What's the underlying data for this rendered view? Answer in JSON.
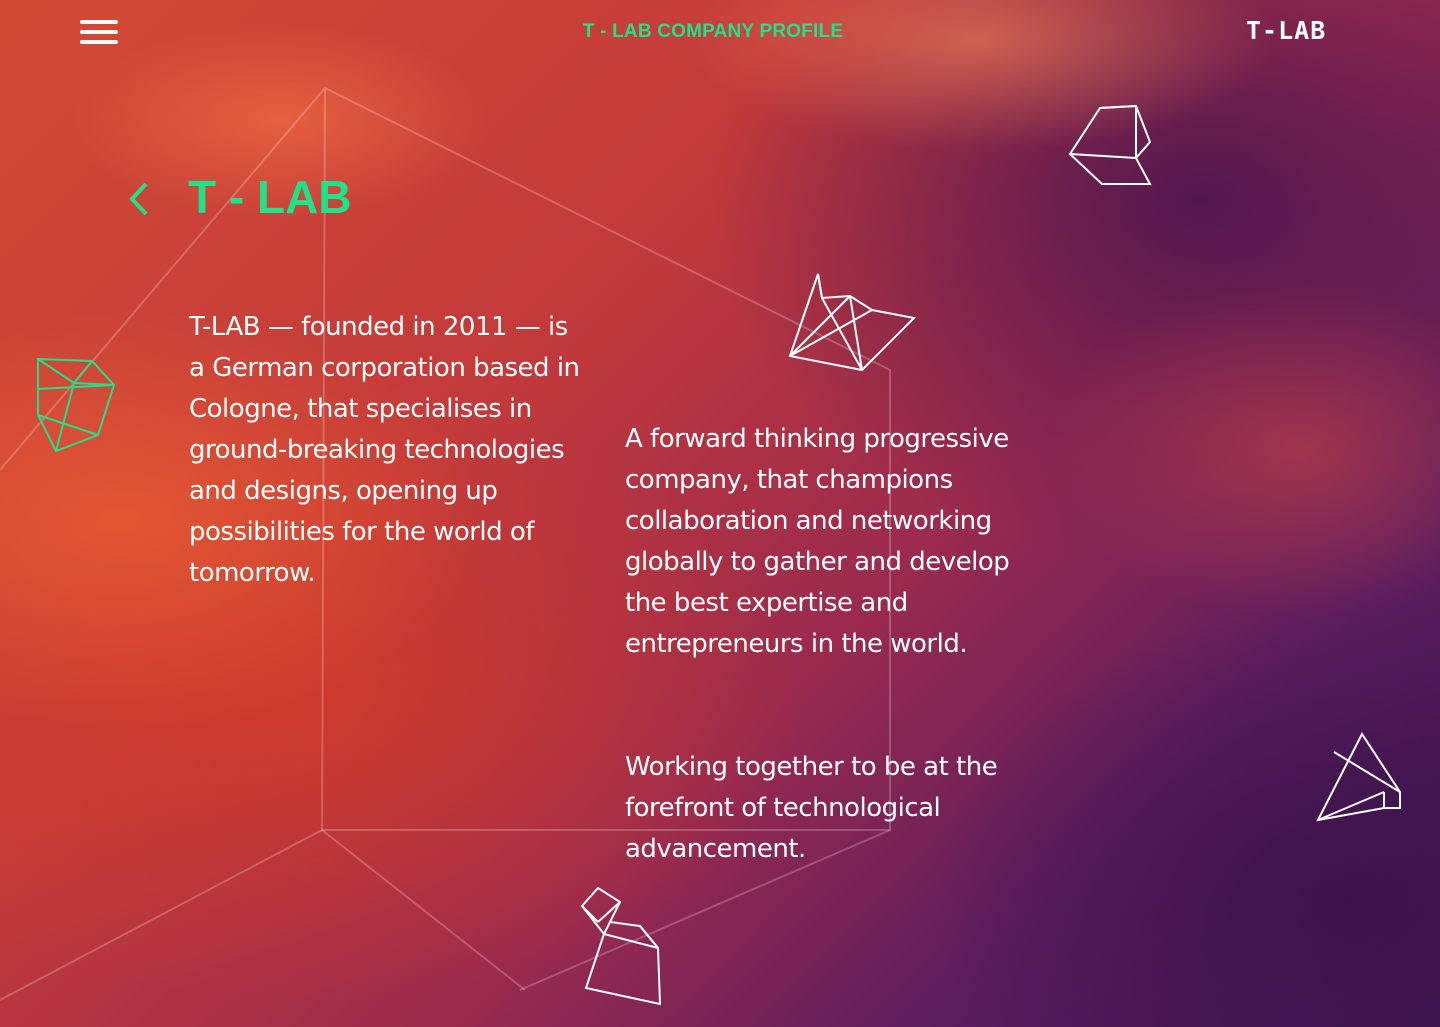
{
  "header": {
    "title": "T - LAB COMPANY PROFILE",
    "menu_icon": "hamburger-menu-icon",
    "logo_text": "T-LAB"
  },
  "main": {
    "back_icon": "chevron-left-icon",
    "title": "T - LAB",
    "intro": "T-LAB — founded in 2011 — is a German corporation based in Cologne, that specialises in ground-breaking technologies and designs, opening up possibilities for the world of tomorrow.",
    "description": "A forward thinking progressive company, that champions collaboration and networking globally to gather and develop the best expertise and entrepreneurs in the world.",
    "tagline": "Working together to be at the forefront of technological advancement."
  },
  "decorations": {
    "icons": [
      "green-crystal-icon",
      "white-crystal-icon"
    ]
  },
  "colors": {
    "accent": "#1ee38a",
    "text": "#ffffff",
    "bg_warm": "#d24a35",
    "bg_cool": "#3b1550"
  }
}
